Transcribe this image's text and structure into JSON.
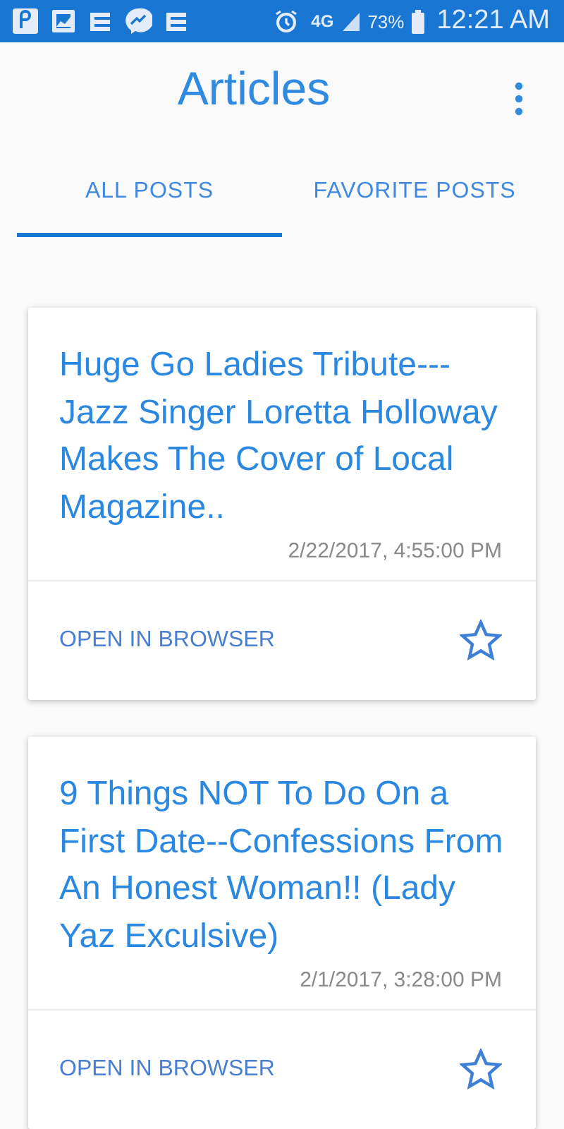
{
  "status_bar": {
    "network": "4G",
    "battery": "73%",
    "time": "12:21 AM"
  },
  "app_bar": {
    "title": "Articles"
  },
  "tabs": [
    {
      "label": "ALL POSTS",
      "selected": true
    },
    {
      "label": "FAVORITE POSTS",
      "selected": false
    }
  ],
  "articles": [
    {
      "title": "Huge Go Ladies Tribute---Jazz Singer Loretta Holloway Makes The Cover of Local Magazine..",
      "date": "2/22/2017, 4:55:00 PM",
      "action": "OPEN IN BROWSER",
      "favorite": false
    },
    {
      "title": "9 Things NOT To Do On a First Date--Confessions From An Honest Woman!! (Lady Yaz Exculsive)",
      "date": "2/1/2017, 3:28:00 PM",
      "action": "OPEN IN BROWSER",
      "favorite": false
    }
  ]
}
